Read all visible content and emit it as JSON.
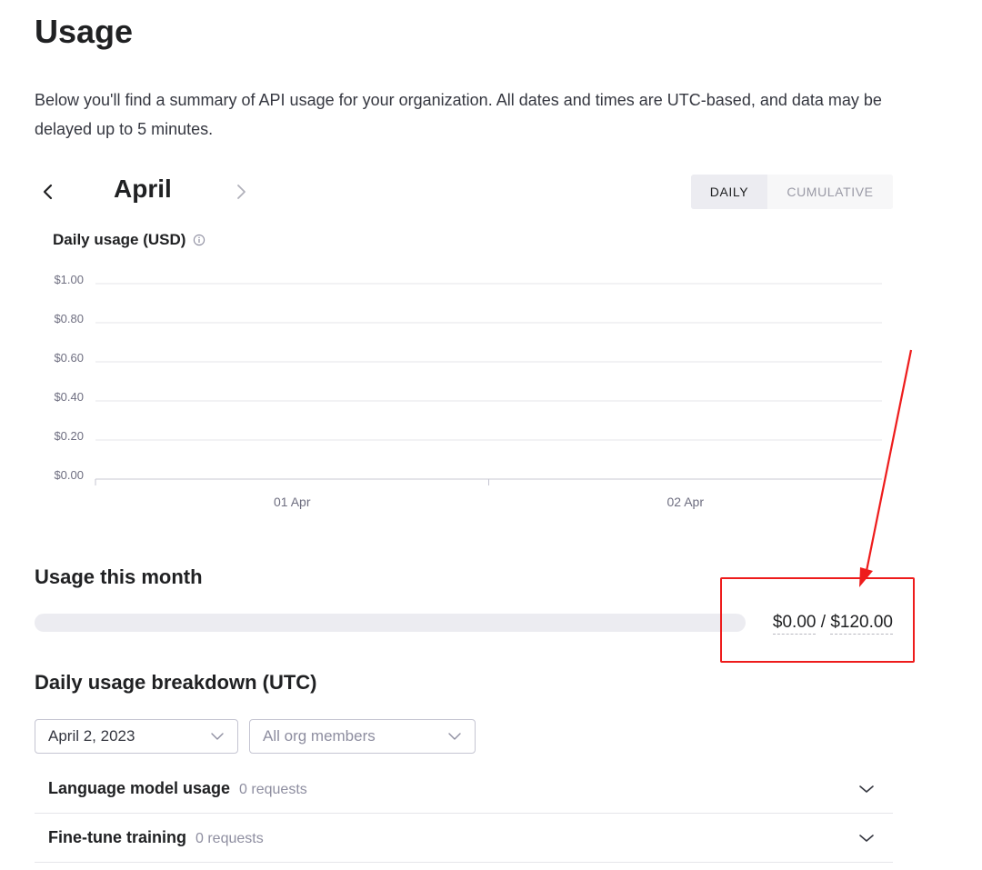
{
  "page": {
    "title": "Usage",
    "intro": "Below you'll find a summary of API usage for your organization. All dates and times are UTC-based, and data may be delayed up to 5 minutes."
  },
  "period": {
    "month": "April",
    "prev_icon": "chevron-left-icon",
    "next_icon": "chevron-right-icon"
  },
  "view_toggle": {
    "daily": "DAILY",
    "cumulative": "CUMULATIVE",
    "active": "daily"
  },
  "chart": {
    "heading": "Daily usage (USD)",
    "info_icon": "info-icon"
  },
  "chart_data": {
    "type": "bar",
    "title": "Daily usage (USD)",
    "categories": [
      "01 Apr",
      "02 Apr"
    ],
    "values": [
      0,
      0
    ],
    "y_ticks": [
      "$0.00",
      "$0.20",
      "$0.40",
      "$0.60",
      "$0.80",
      "$1.00"
    ],
    "ylim": [
      0,
      1.0
    ],
    "grid": true
  },
  "usage_month": {
    "title": "Usage this month",
    "used": "$0.00",
    "separator": "/",
    "limit": "$120.00",
    "fraction": 0
  },
  "breakdown": {
    "title": "Daily usage breakdown (UTC)",
    "date_select": "April 2, 2023",
    "member_select": "All org members",
    "rows": [
      {
        "title": "Language model usage",
        "count": "0 requests"
      },
      {
        "title": "Fine-tune training",
        "count": "0 requests"
      }
    ]
  },
  "colors": {
    "accent": "#10a37f",
    "annotation": "#ee1c1c",
    "grid": "#e5e5ea"
  }
}
